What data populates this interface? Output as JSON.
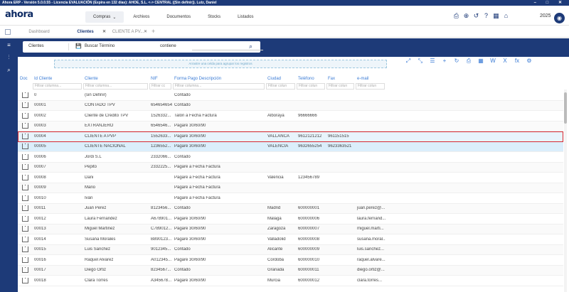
{
  "window": {
    "title": "Ahora ERP - Versión 5.0.0.55 - Licencia EVALUACIÓN (Expira en 132 días): AHOE, S.L. <-> CENTRAL ((Sin definir)). Lutz, Daniel",
    "controls": "– □ ✕"
  },
  "app": {
    "logo": "ahora",
    "year": "2025",
    "avatar": "◉",
    "menu": [
      {
        "label": "Compras",
        "caret": "⌄"
      },
      {
        "label": "Archivos"
      },
      {
        "label": "Documentos"
      },
      {
        "label": "Stocks"
      },
      {
        "label": "Listados"
      }
    ],
    "icons": [
      "⎙",
      "⊕",
      "↺",
      "?",
      "▦",
      "⌂"
    ]
  },
  "tabs": [
    {
      "label": "Dashboard"
    },
    {
      "label": "Clientes",
      "close": "✕"
    },
    {
      "label": "CLIENTE A PV...",
      "close": "✕"
    }
  ],
  "tab_add": "+",
  "sidebar": {
    "icons": [
      "≡",
      "⫶",
      "⌕"
    ]
  },
  "search": {
    "entity": "Clientes",
    "save_icon": "💾",
    "label": "Buscar Término",
    "operator": "contiene",
    "term": "",
    "search_icon": "⌕"
  },
  "grid": {
    "group_hint": "Arrastre una celda para agrupar los registros",
    "toolbar": [
      "⤢",
      "⤡",
      "☰",
      "+",
      "↻",
      "⎙",
      "▦",
      "W",
      "X",
      "fx",
      "⚙"
    ],
    "columns": [
      "Doc",
      "Id Cliente",
      "Cliente",
      "NIF",
      "Forma Pago Descripción",
      "Ciudad",
      "Teléfono",
      "Fax",
      "e-mail"
    ],
    "filters": [
      "",
      "Filtrar columna...",
      "Filtrar columna...",
      "Filtrar cc",
      "Filtrar columna...",
      "Filtrar colun",
      "Filtrar colun",
      "Filtrar colun",
      "Filtrar colun"
    ],
    "rows": [
      [
        "",
        "0",
        "(sin Definir)",
        "",
        "Contado",
        "",
        "",
        "",
        ""
      ],
      [
        "",
        "00001",
        "CONTADO TPV",
        "654654654",
        "Contado",
        "",
        "",
        "",
        ""
      ],
      [
        "",
        "00002",
        "Cliente de Crédito TPV",
        "1526332...",
        "Talón a Fecha Factura",
        "Alboraya",
        "96666666",
        "",
        ""
      ],
      [
        "",
        "00003",
        "EXTRANJERO",
        "6546546...",
        "Pagaré 30/60/90",
        "",
        "",
        "",
        ""
      ],
      [
        "",
        "00004",
        "CLIENTE A PVP",
        "1552633...",
        "Pagaré 30/60/90",
        "VALLANCA",
        "9612121212",
        "961151515",
        ""
      ],
      [
        "",
        "00005",
        "CLIENTE NACIONAL",
        "1236552...",
        "Pagaré 30/60/90",
        "VALENCIA",
        "9632655254",
        "9623363521",
        ""
      ],
      [
        "",
        "00006",
        "Jordi S.L",
        "2332066...",
        "Contado",
        "",
        "",
        "",
        ""
      ],
      [
        "",
        "00007",
        "Pepito",
        "2332225...",
        "Pagaré a Fecha Factura",
        "",
        "",
        "",
        ""
      ],
      [
        "",
        "00008",
        "Dani",
        "",
        "Pagaré a Fecha Factura",
        "Valencia",
        "123456789",
        "",
        ""
      ],
      [
        "",
        "00009",
        "Mario",
        "",
        "Pagaré a Fecha Factura",
        "",
        "",
        "",
        ""
      ],
      [
        "",
        "00010",
        "Iván",
        "",
        "Pagaré a Fecha Factura",
        "",
        "",
        "",
        ""
      ],
      [
        "",
        "00011",
        "Juan Perez",
        "8123456...",
        "Contado",
        "Madrid",
        "600000001",
        "",
        "juan.perez@..."
      ],
      [
        "",
        "00012",
        "Laura Fernandez",
        "A678901...",
        "Pagaré 30/60/90",
        "Malaga",
        "600000006",
        "",
        "laura.fernand..."
      ],
      [
        "",
        "00013",
        "Miguel Martinez",
        "C789012...",
        "Pagaré 30/60/90",
        "Zaragoza",
        "600000007",
        "",
        "miguel.marti..."
      ],
      [
        "",
        "00014",
        "Susana Morales",
        "B890123...",
        "Pagaré 30/60/90",
        "Valladolid",
        "600000008",
        "",
        "susana.moral..."
      ],
      [
        "",
        "00015",
        "Luis Sanchez",
        "9012345...",
        "Contado",
        "Alicante",
        "600000009",
        "",
        "luis.sanchez..."
      ],
      [
        "",
        "00016",
        "Raquel Alvarez",
        "A012345...",
        "Pagaré 30/60/90",
        "Cordoba",
        "600000010",
        "",
        "raquel.alvare..."
      ],
      [
        "",
        "00017",
        "Diego Ortiz",
        "8234567...",
        "Contado",
        "Granada",
        "600000011",
        "",
        "diego.ortiz@..."
      ],
      [
        "",
        "00018",
        "Clara Torres",
        "A345678...",
        "Pagaré 30/60/90",
        "Murcia",
        "600000012",
        "",
        "clara.torres..."
      ]
    ]
  },
  "colors": {
    "brand": "#1d3a78",
    "accent": "#3a7bd5",
    "selection_border": "#d6282f"
  }
}
